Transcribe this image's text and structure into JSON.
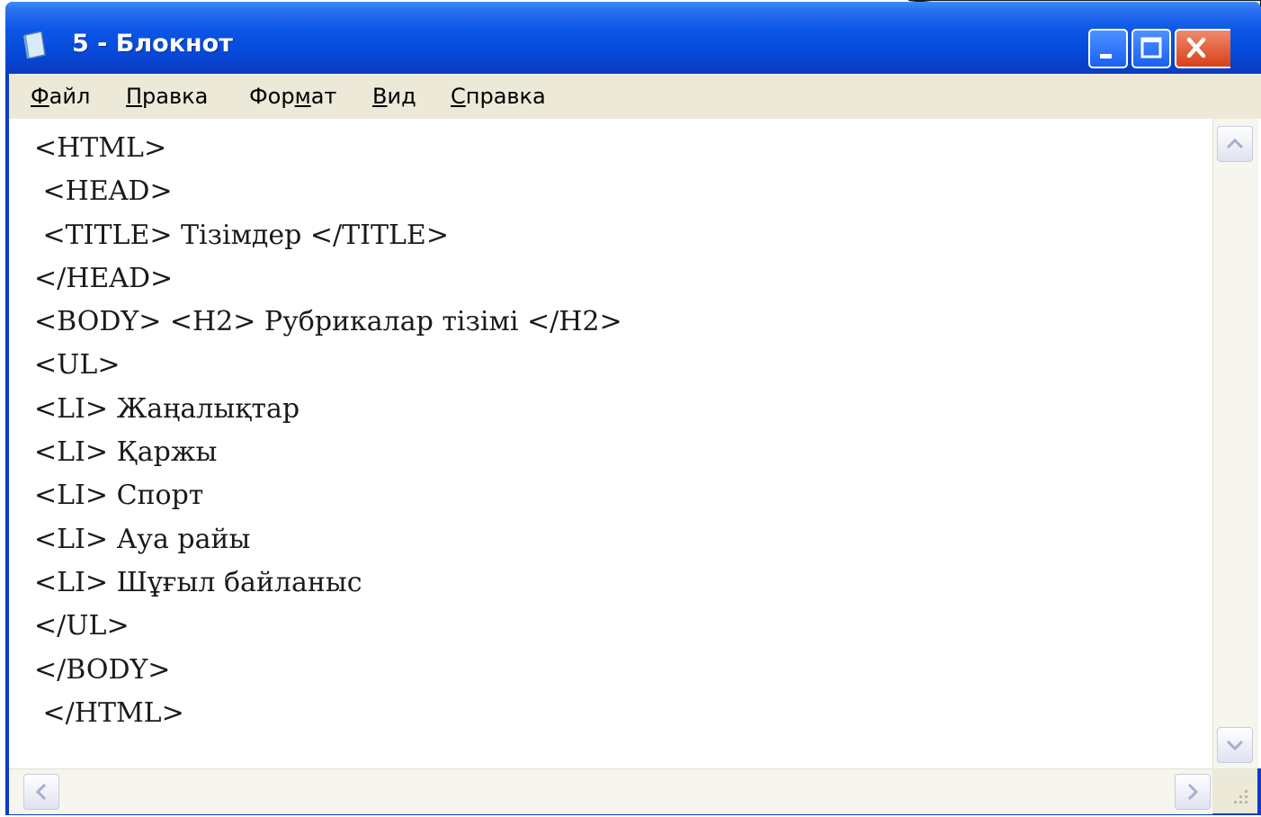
{
  "window": {
    "title": "5 - Блокнот",
    "controls": {
      "minimize": "minimize",
      "maximize": "maximize",
      "close": "close"
    }
  },
  "menu": {
    "items": [
      {
        "first": "Ф",
        "rest": "айл"
      },
      {
        "first": "П",
        "rest": "равка"
      },
      {
        "first": "Фор",
        "underlined": "м",
        "rest": "ат"
      },
      {
        "first": "В",
        "rest": "ид"
      },
      {
        "first": "С",
        "rest": "правка"
      }
    ]
  },
  "editor": {
    "content": "<HTML>\n <HEAD>\n <TITLE> Тізімдер </TITLE>\n</HEAD>\n<BODY> <H2> Рубрикалар тізімі </H2>\n<UL>\n<LI> Жаңалықтар\n<LI> Қаржы\n<LI> Спорт\n<LI> Ауа райы\n<LI> Шұғыл байланыс\n</UL>\n</BODY>\n </HTML>"
  },
  "colors": {
    "titlebar": "#0a56e6",
    "menubar": "#ece9d8",
    "callout_fill": "#c8f5b8",
    "close_button": "#d8401c"
  },
  "icons": [
    "notepad-icon",
    "minimize-icon",
    "maximize-icon",
    "close-icon",
    "scroll-up-arrow-icon",
    "scroll-down-arrow-icon",
    "scroll-left-arrow-icon",
    "scroll-right-arrow-icon",
    "size-grip-icon"
  ]
}
